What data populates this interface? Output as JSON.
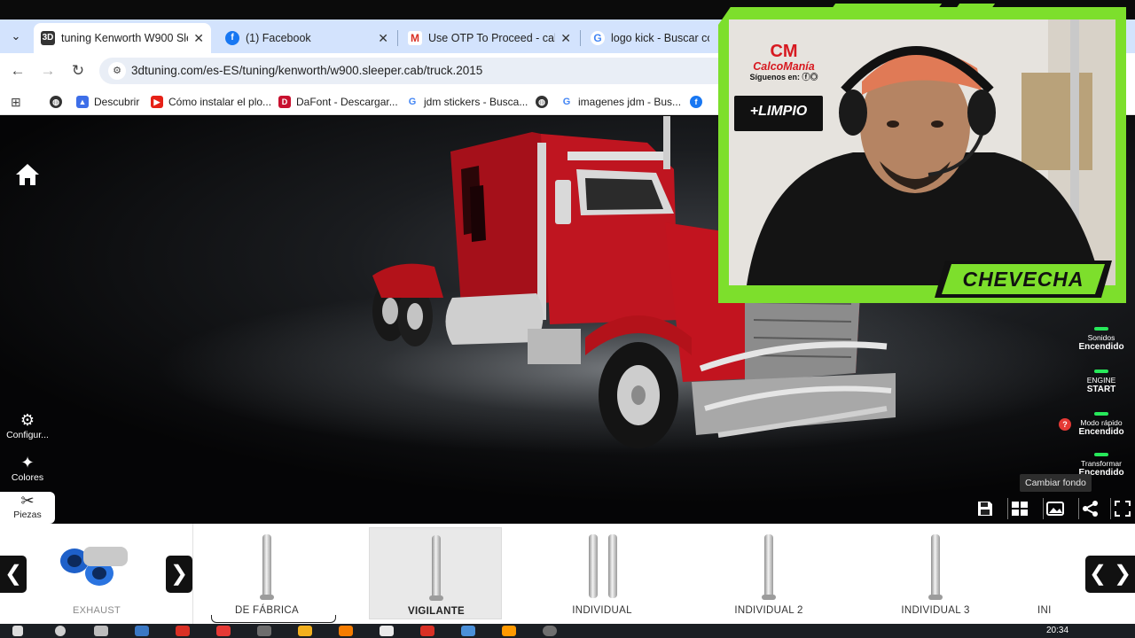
{
  "browser": {
    "tabs": [
      {
        "title": "tuning Kenworth W900 Slee",
        "favicon": "3d-tuning-icon",
        "active": true
      },
      {
        "title": "(1) Facebook",
        "favicon": "facebook-icon",
        "active": false
      },
      {
        "title": "Use OTP To Proceed - calco",
        "favicon": "gmail-icon",
        "active": false
      },
      {
        "title": "logo kick - Buscar con G",
        "favicon": "google-icon",
        "active": false
      }
    ],
    "url": "3dtuning.com/es-ES/tuning/kenworth/w900.sleeper.cab/truck.2015",
    "bookmarks": [
      {
        "label": "",
        "icon": "globe-icon"
      },
      {
        "label": "Descubrir",
        "icon": "discover-icon"
      },
      {
        "label": "Cómo instalar el plo...",
        "icon": "youtube-icon"
      },
      {
        "label": "DaFont - Descargar...",
        "icon": "dafont-icon"
      },
      {
        "label": "jdm stickers - Busca...",
        "icon": "google-icon"
      },
      {
        "label": "",
        "icon": "globe-icon"
      },
      {
        "label": "imagenes jdm - Bus...",
        "icon": "google-icon"
      },
      {
        "label": "",
        "icon": "facebook-icon"
      }
    ]
  },
  "sidebar": {
    "home_icon": "home-icon",
    "items": [
      {
        "label": "Configur...",
        "icon": "car-config-icon"
      },
      {
        "label": "Colores",
        "icon": "paint-icon"
      },
      {
        "label": "Piezas",
        "icon": "tools-icon"
      }
    ]
  },
  "toggles": [
    {
      "line1": "Sonidos",
      "line2": "Encendido"
    },
    {
      "line1": "ENGINE",
      "line2": "START"
    },
    {
      "line1": "Modo rápido",
      "line2": "Encendido"
    },
    {
      "line1": "Transformar",
      "line2": "Encendido"
    }
  ],
  "help_badge": "?",
  "tooltip": "Cambiar fondo",
  "actions": [
    "save-icon",
    "gallery-icon",
    "background-icon",
    "share-icon",
    "fullscreen-icon"
  ],
  "parts": {
    "category": "EXHAUST",
    "options": [
      {
        "label": "DE FÁBRICA",
        "selected": false
      },
      {
        "label": "VIGILANTE",
        "selected": true
      },
      {
        "label": "INDIVIDUAL",
        "selected": false
      },
      {
        "label": "INDIVIDUAL 2",
        "selected": false
      },
      {
        "label": "INDIVIDUAL 3",
        "selected": false
      },
      {
        "label": "INI",
        "selected": false
      }
    ]
  },
  "taskbar": {
    "time": "20:34"
  },
  "overlay": {
    "logo_initials": "CM",
    "logo_name": "CalcoManía",
    "logo_follow": "Síguenos en:",
    "sponsor": "+LIMPIO",
    "streamer_name": "CHEVECHA"
  },
  "colors": {
    "accent_green": "#7ddf2c",
    "truck_red": "#b3121a",
    "tab_bar": "#d3e3fd"
  }
}
